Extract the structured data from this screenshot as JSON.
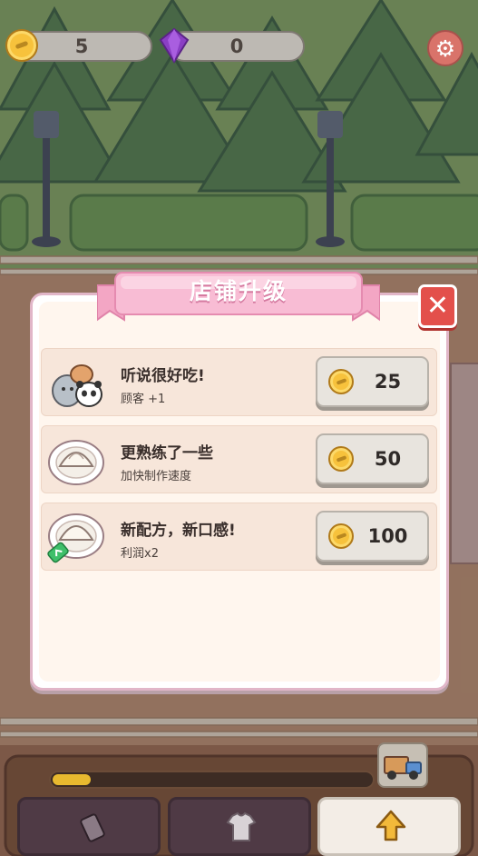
{
  "hud": {
    "coins": "5",
    "gems": "0",
    "coin_icon": "gold-coin-icon",
    "gem_icon": "purple-gem-icon",
    "settings_icon": "gear-icon"
  },
  "dialog": {
    "title": "店铺升级",
    "close_icon": "close-x-icon",
    "upgrades": [
      {
        "title": "听说很好吃!",
        "desc": "顾客 +1",
        "price": "25",
        "thumb_icon": "customer-animals-icon"
      },
      {
        "title": "更熟练了一些",
        "desc": "加快制作速度",
        "price": "50",
        "thumb_icon": "bun-plate-icon"
      },
      {
        "title": "新配方，新口感!",
        "desc": "利润x2",
        "price": "100",
        "thumb_icon": "bun-plate-with-tag-icon"
      }
    ]
  },
  "bottom": {
    "progress": 0.12,
    "truck_icon": "delivery-truck-icon",
    "nav": [
      {
        "icon": "card-icon",
        "active": false
      },
      {
        "icon": "shirt-icon",
        "active": false
      },
      {
        "icon": "upgrade-arrow-icon",
        "active": true
      }
    ]
  },
  "colors": {
    "accent_pink": "#f3a6c4",
    "close_red": "#e3504b",
    "coin_gold": "#f7c23c",
    "gem_purple": "#8a3fc4"
  }
}
